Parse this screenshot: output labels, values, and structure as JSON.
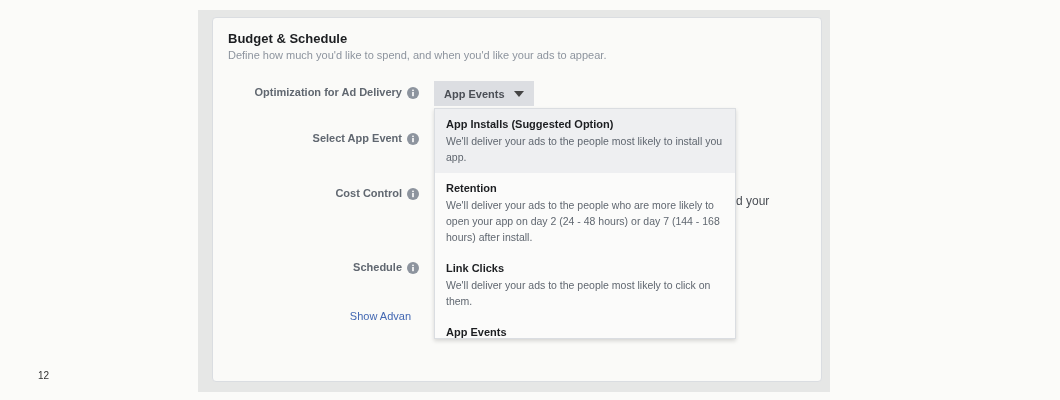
{
  "page_number": "12",
  "section": {
    "title": "Budget & Schedule",
    "subtitle": "Define how much you'd like to spend, and when you'd like your ads to appear."
  },
  "fields": [
    {
      "label": "Optimization for Ad Delivery",
      "kind": "dropdown",
      "value": "App Events",
      "expanded": true
    },
    {
      "label": "Select App Event",
      "kind": "empty"
    },
    {
      "label": "Cost Control",
      "kind": "fragment",
      "value": "d your"
    },
    {
      "label": "Schedule",
      "kind": "empty"
    }
  ],
  "advanced_link": "Show Advan",
  "menu": [
    {
      "title": "App Installs (Suggested Option)",
      "description": "We'll deliver your ads to the people most likely to install you app.",
      "selected": true
    },
    {
      "title": "Retention",
      "description": "We'll deliver your ads to the people who are more likely to open your app on day 2 (24 - 48 hours) or day 7 (144 - 168 hours) after install.",
      "selected": false
    },
    {
      "title": "Link Clicks",
      "description": "We'll deliver your ads to the people most likely to click on them.",
      "selected": false
    },
    {
      "title": "App Events",
      "selected": false
    }
  ]
}
